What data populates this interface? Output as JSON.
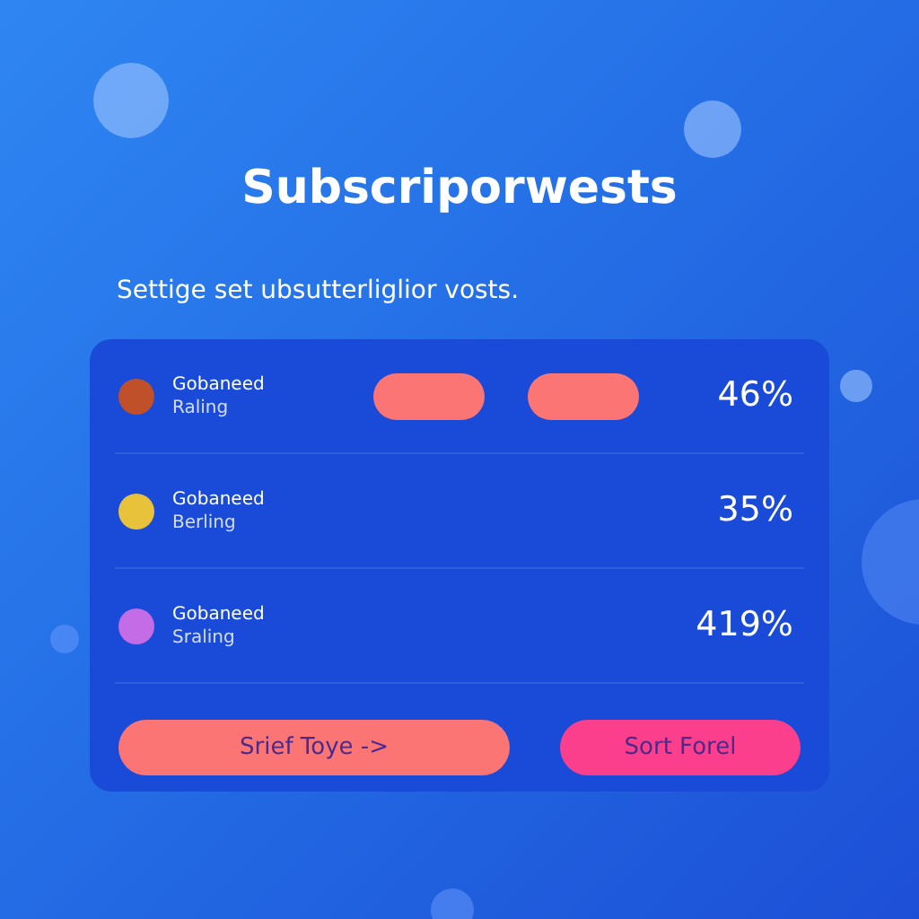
{
  "title": "Subscriporwests",
  "subtitle": "Settige set ubsutterliglior vosts.",
  "rows": [
    {
      "kind": "pills",
      "name": "Gobaneed",
      "sub": "Raling",
      "value": "46%",
      "color": "#c0502a"
    },
    {
      "kind": "plain",
      "name": "Gobaneed",
      "sub": "Berling",
      "value": "35%",
      "color": "#e8c23a"
    },
    {
      "kind": "plain",
      "name": "Gobaneed",
      "sub": "Sraling",
      "value": "419%",
      "color": "#c46be6"
    }
  ],
  "buttons": [
    {
      "label": "Srief Toye ->",
      "color": "#fb7575"
    },
    {
      "label": "Sort Forel",
      "color": "#fb3f8c"
    }
  ]
}
